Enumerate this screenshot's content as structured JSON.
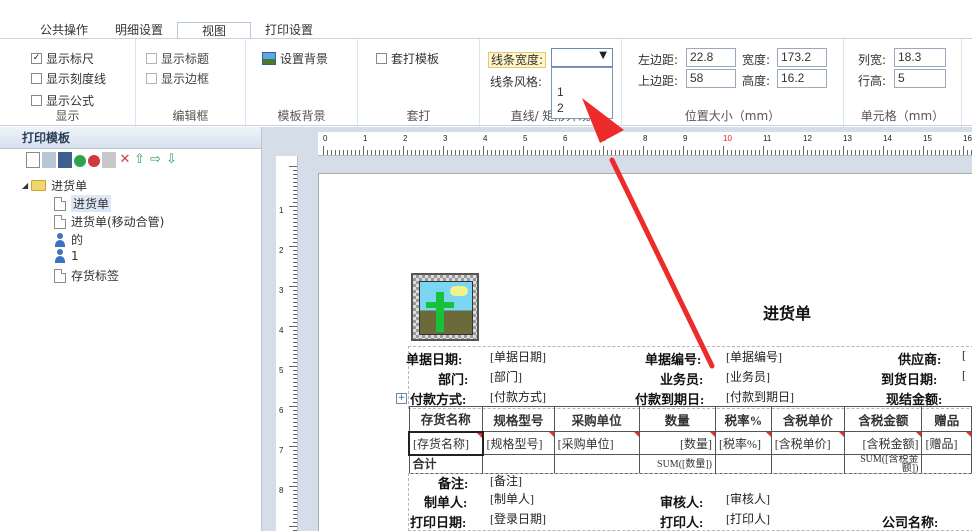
{
  "tabs": [
    "公共操作",
    "明细设置",
    "视图",
    "打印设置"
  ],
  "ribbon": {
    "show_group": {
      "items": [
        "显示标尺",
        "显示刻度线",
        "显示公式"
      ],
      "checked": [
        true,
        false,
        false
      ],
      "label": "显示"
    },
    "edit_group": {
      "items": [
        "显示标题",
        "显示边框"
      ],
      "label": "编辑框"
    },
    "bg_group": {
      "button": "设置背景",
      "label": "模板背景"
    },
    "overlay_group": {
      "item": "套打模板",
      "label": "套打"
    },
    "line_group": {
      "width_label": "线条宽度:",
      "style_label": "线条风格:",
      "options": [
        "1",
        "2"
      ],
      "label": "直线/ 矩形外观"
    },
    "position_group": {
      "left_label": "左边距:",
      "left": "22.8",
      "width_label": "宽度:",
      "width": "173.2",
      "top_label": "上边距:",
      "top": "58",
      "height_label": "高度:",
      "height": "16.2",
      "label": "位置大小（mm）"
    },
    "cell_group": {
      "colw_label": "列宽:",
      "colw": "18.3",
      "rowh_label": "行高:",
      "rowh": "5",
      "label": "单元格（mm）"
    }
  },
  "panel": {
    "title": "打印模板",
    "tree": {
      "root": "进货单",
      "children": [
        "进货单",
        "进货单(移动合管)",
        "的",
        "1",
        "存货标签"
      ]
    }
  },
  "rulers": {
    "top": [
      "0",
      "1",
      "2",
      "3",
      "4",
      "5",
      "6",
      "7",
      "8",
      "9",
      "10",
      "11",
      "12",
      "13",
      "14",
      "15",
      "16"
    ],
    "left": [
      "1",
      "2",
      "3",
      "4",
      "5",
      "6",
      "7",
      "8"
    ]
  },
  "report": {
    "title": "进货单",
    "labels": {
      "bill_date": "单据日期:",
      "dept": "部门:",
      "payment": "付款方式:",
      "bill_no": "单据编号:",
      "salesman": "业务员:",
      "pay_due": "付款到期日:",
      "supplier": "供应商:",
      "arrive_date": "到货日期:",
      "cash_amount": "现结金额:",
      "remark": "备注:",
      "maker": "制单人:",
      "auditor": "审核人:",
      "print_date": "打印日期:",
      "printer": "打印人:",
      "company": "公司名称:"
    },
    "fields": {
      "bill_date": "[单据日期]",
      "dept": "[部门]",
      "payment": "[付款方式]",
      "bill_no": "[单据编号]",
      "salesman": "[业务员]",
      "pay_due": "[付款到期日]",
      "supplier": "[",
      "arrive_date": "[",
      "remark": "[备注]",
      "maker": "[制单人]",
      "auditor": "[审核人]",
      "print_date": "[登录日期]",
      "printer": "[打印人]"
    },
    "table": {
      "headers": [
        "存货名称",
        "规格型号",
        "采购单位",
        "数量",
        "税率%",
        "含税单价",
        "含税金额",
        "赠品"
      ],
      "row": [
        "[存货名称]",
        "[规格型号]",
        "[采购单位]",
        "[数量]",
        "[税率%]",
        "[含税单价]",
        "[含税金额]",
        "[赠品]"
      ],
      "total_label": "合计",
      "total_qty": "SUM([数量])",
      "total_amount": "SUM([含税金额])"
    }
  }
}
